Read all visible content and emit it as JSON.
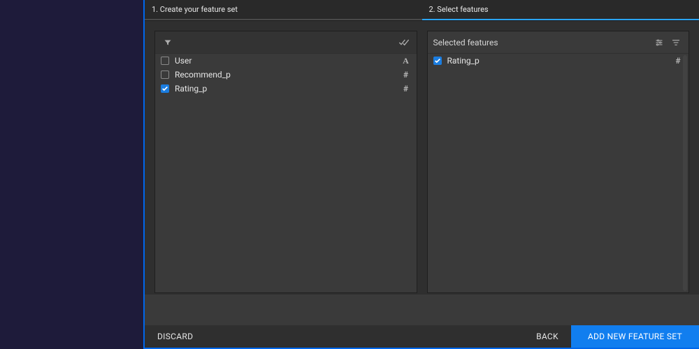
{
  "steps": {
    "one": "1. Create your feature set",
    "two": "2. Select features"
  },
  "left": {
    "items": [
      {
        "label": "User",
        "type": "A",
        "checked": false
      },
      {
        "label": "Recommend_p",
        "type": "#",
        "checked": false
      },
      {
        "label": "Rating_p",
        "type": "#",
        "checked": true
      }
    ]
  },
  "right": {
    "title": "Selected features",
    "items": [
      {
        "label": "Rating_p",
        "type": "#",
        "checked": true
      }
    ]
  },
  "footer": {
    "discard": "DISCARD",
    "back": "BACK",
    "add": "ADD NEW FEATURE SET"
  }
}
